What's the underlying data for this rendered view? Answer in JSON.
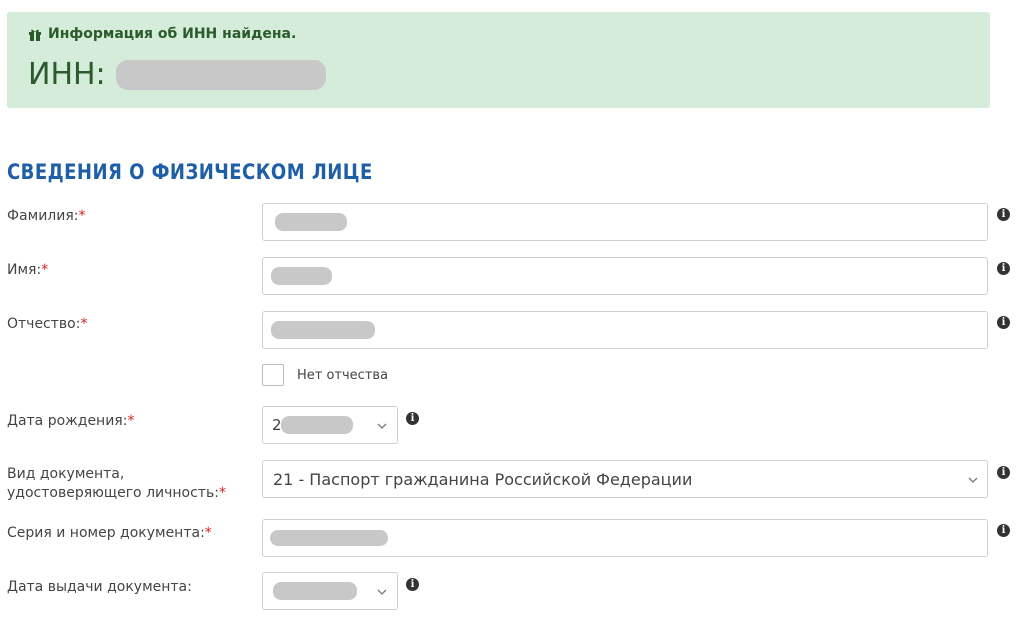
{
  "alert": {
    "heading": "Информация об ИНН найдена.",
    "inn_label": "ИНН:"
  },
  "section": {
    "title": "СВЕДЕНИЯ О ФИЗИЧЕСКОМ ЛИЦЕ"
  },
  "fields": {
    "surname": {
      "label": "Фамилия:",
      "required": "*"
    },
    "name": {
      "label": "Имя:",
      "required": "*"
    },
    "patronymic": {
      "label": "Отчество:",
      "required": "*"
    },
    "no_patronymic": {
      "label": "Нет отчества"
    },
    "birth_date": {
      "label": "Дата рождения:",
      "required": "*"
    },
    "doc_type": {
      "label_line1": "Вид документа,",
      "label_line2": "удостоверяющего личность:",
      "required": "*",
      "value": "21 - Паспорт гражданина Российской Федерации"
    },
    "doc_number": {
      "label": "Серия и номер документа:",
      "required": "*"
    },
    "issue_date": {
      "label": "Дата выдачи документа:"
    }
  },
  "icons": {
    "gift": "gift-icon",
    "info": "info-icon",
    "chevron": "chevron-down-icon"
  },
  "colors": {
    "alert_bg": "#d4ecd9",
    "alert_text": "#2b5a2b",
    "section_title": "#1f5fa8",
    "required": "#d9231e"
  }
}
